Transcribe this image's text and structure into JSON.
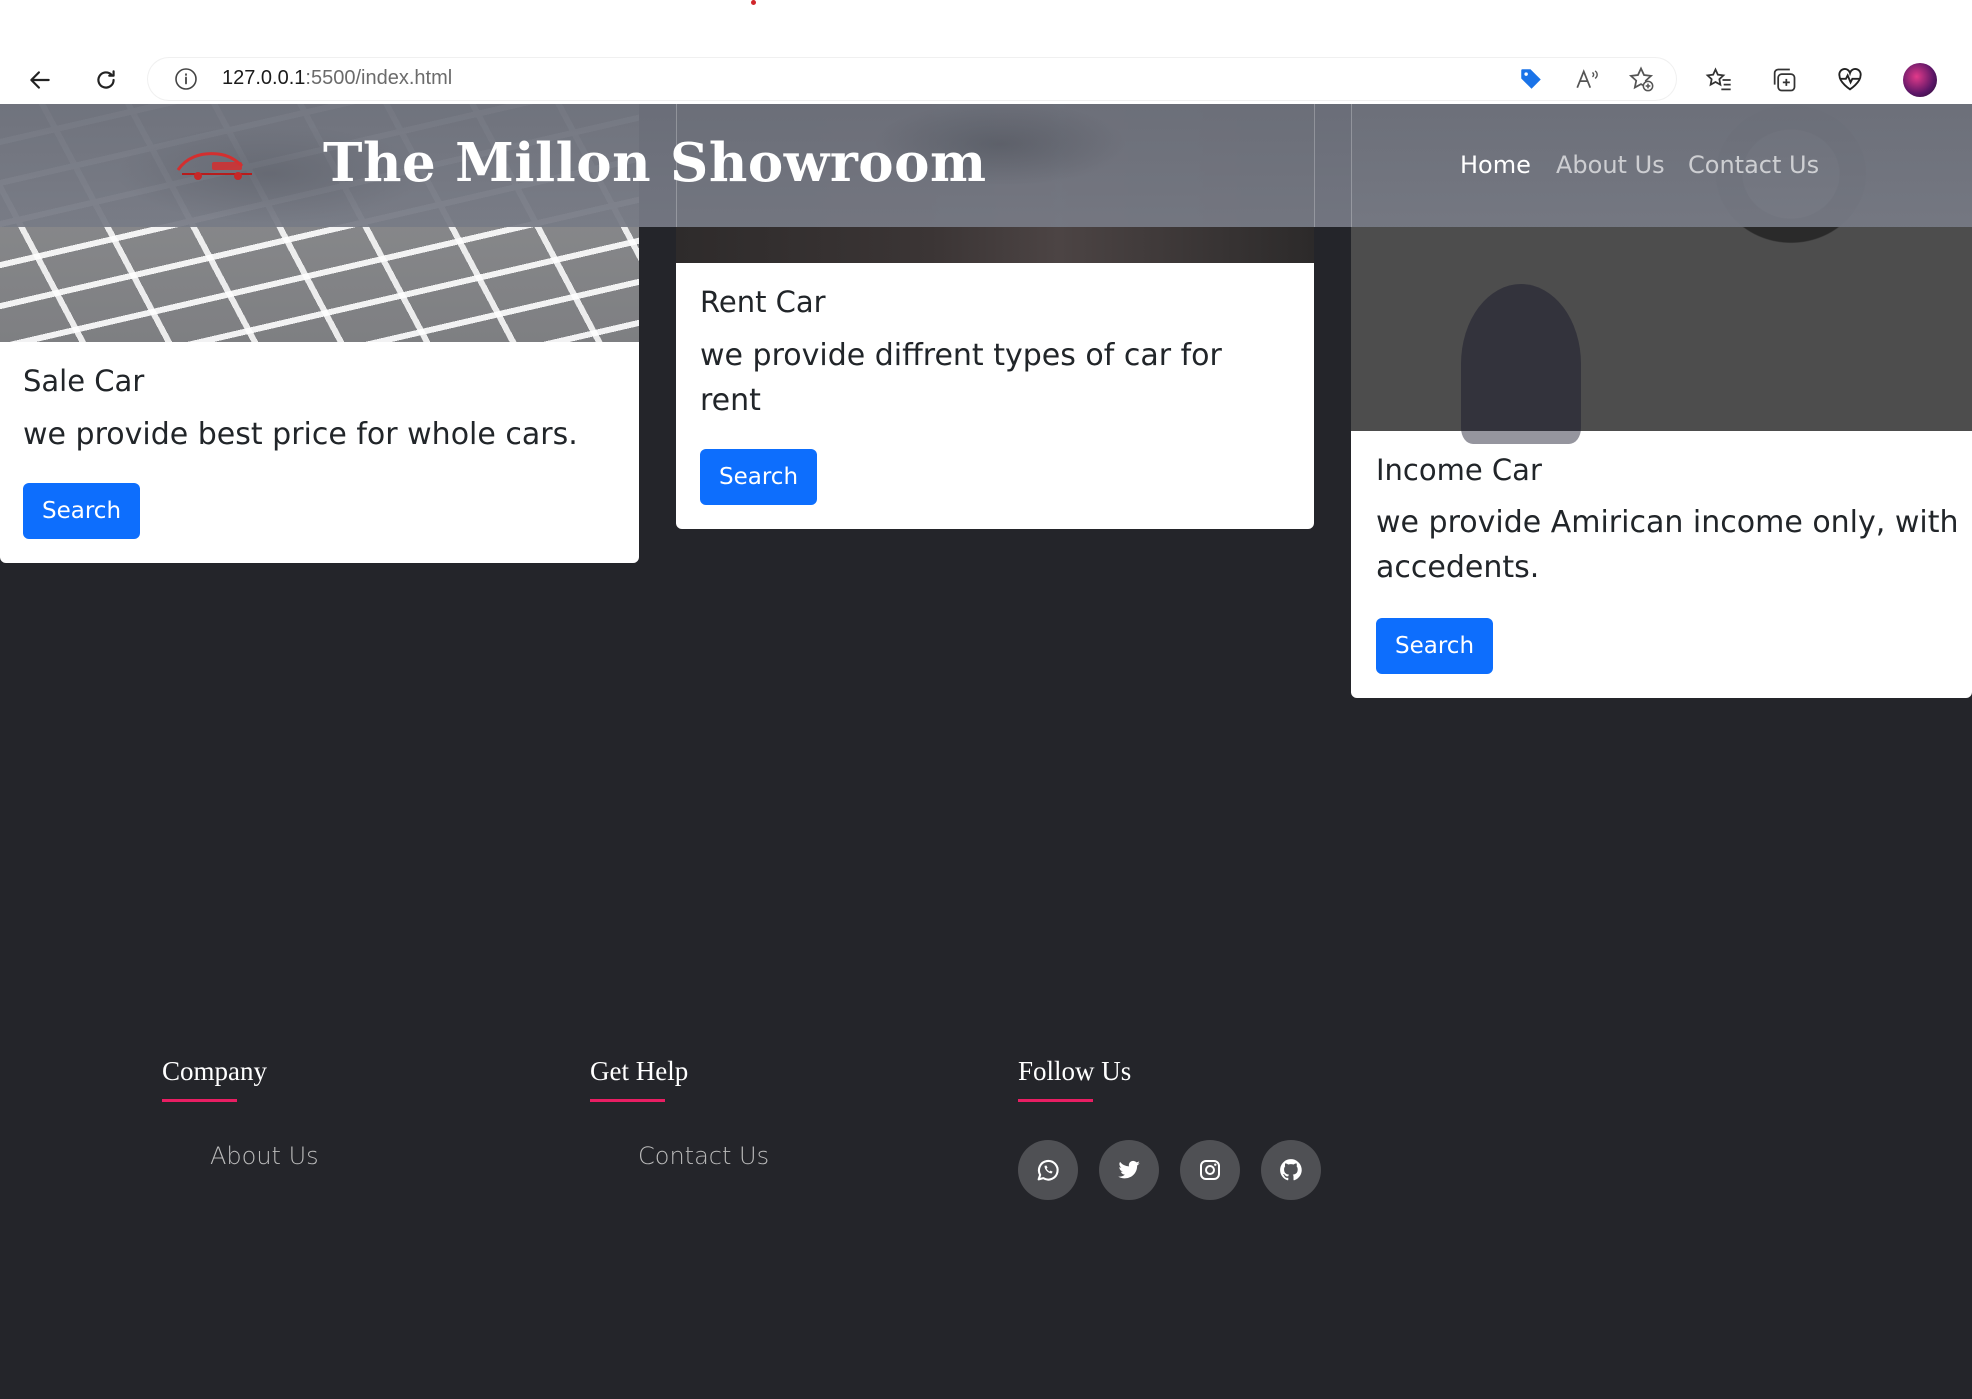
{
  "browser": {
    "url_host": "127.0.0.1",
    "url_rest": ":5500/index.html"
  },
  "navbar": {
    "title": "The Millon Showroom",
    "links": [
      {
        "label": "Home",
        "active": true
      },
      {
        "label": "About Us",
        "active": false
      },
      {
        "label": "Contact Us",
        "active": false
      }
    ]
  },
  "cards": [
    {
      "title": "Sale Car",
      "text": "we provide best price for whole cars.",
      "button": "Search"
    },
    {
      "title": "Rent Car",
      "text": "we provide diffrent types of car for rent",
      "button": "Search"
    },
    {
      "title": "Income Car",
      "text": "we provide Amirican income only, with accedents.",
      "button": "Search"
    }
  ],
  "footer": {
    "columns": [
      {
        "heading": "Company",
        "links": [
          "About Us"
        ]
      },
      {
        "heading": "Get Help",
        "links": [
          "Contact Us"
        ]
      },
      {
        "heading": "Follow Us",
        "social": [
          "whatsapp-icon",
          "twitter-icon",
          "instagram-icon",
          "github-icon"
        ]
      }
    ]
  },
  "colors": {
    "page_bg": "#24252a",
    "primary_button": "#0d6efd",
    "footer_accent": "#e91e63"
  }
}
